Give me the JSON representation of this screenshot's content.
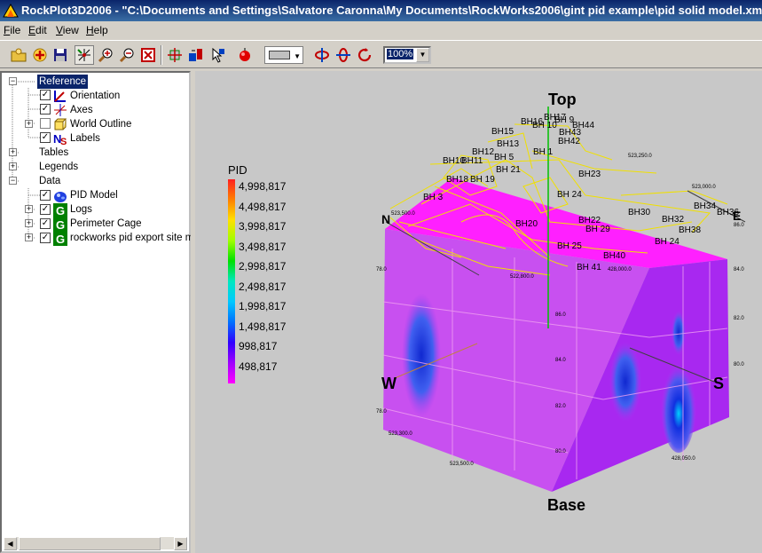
{
  "window": {
    "title": "RockPlot3D2006 - \"C:\\Documents and Settings\\Salvatore Caronna\\My Documents\\RockWorks2006\\gint pid example\\pid solid model.xml\""
  },
  "menu": [
    {
      "label": "File",
      "key": "F"
    },
    {
      "label": "Edit",
      "key": "E"
    },
    {
      "label": "View",
      "key": "V"
    },
    {
      "label": "Help",
      "key": "H"
    }
  ],
  "toolbar": {
    "zoom_value": "100%",
    "color_swatch": "#c0c0c0"
  },
  "tree": [
    {
      "label": "Reference",
      "selected": true
    },
    {
      "label": "Orientation"
    },
    {
      "label": "Axes"
    },
    {
      "label": "World Outline"
    },
    {
      "label": "Labels"
    },
    {
      "label": "Tables"
    },
    {
      "label": "Legends"
    },
    {
      "label": "Data"
    },
    {
      "label": "PID Model"
    },
    {
      "label": "Logs"
    },
    {
      "label": "Perimeter Cage"
    },
    {
      "label": "rockworks pid export site ma"
    }
  ],
  "legend": {
    "title": "PID",
    "labels": [
      "4,998,817",
      "4,498,817",
      "3,998,817",
      "3,498,817",
      "2,998,817",
      "2,498,817",
      "1,998,817",
      "1,498,817",
      "998,817",
      "498,817"
    ],
    "colors": [
      "#ff2020",
      "#ff8000",
      "#ffe000",
      "#a0ff00",
      "#00e000",
      "#00e8c0",
      "#00c8ff",
      "#0070ff",
      "#3000ff",
      "#a000ff",
      "#ff00ff"
    ]
  },
  "scene": {
    "top_label": "Top",
    "base_label": "Base",
    "west_label": "W",
    "south_label": "S",
    "north_label": "N",
    "east_label": "E",
    "colors": {
      "solid": "#e040f0",
      "solid_top": "#ff20ff",
      "solid_side": "#a020f0",
      "outline": "#f0e000",
      "blue": "#1830e0",
      "plume": "#5058f0"
    },
    "boreholes": [
      "BH17",
      "BH 9",
      "BH16",
      "BH 10",
      "BH44",
      "BH43",
      "BH42",
      "BH15",
      "BH13",
      "BH 1",
      "BH12",
      "BH 5",
      "BH10",
      "BH11",
      "BH 21",
      "BH18",
      "BH 19",
      "BH 3",
      "BH23",
      "BH 24",
      "BH20",
      "BH22",
      "BH 29",
      "BH30",
      "BH32",
      "BH34",
      "BH36",
      "BH38",
      "BH 25",
      "BH 24",
      "BH40",
      "BH 41"
    ],
    "coords": [
      "523,250.0",
      "523,000.0",
      "523,500.0",
      "522,800.0",
      "428,000.0",
      "428,050.0",
      "86.0",
      "84.0",
      "82.0",
      "80.0",
      "78.0",
      "86.0",
      "84.0",
      "82.0",
      "80.0",
      "78.0",
      "523,300.0",
      "523,500.0"
    ]
  }
}
